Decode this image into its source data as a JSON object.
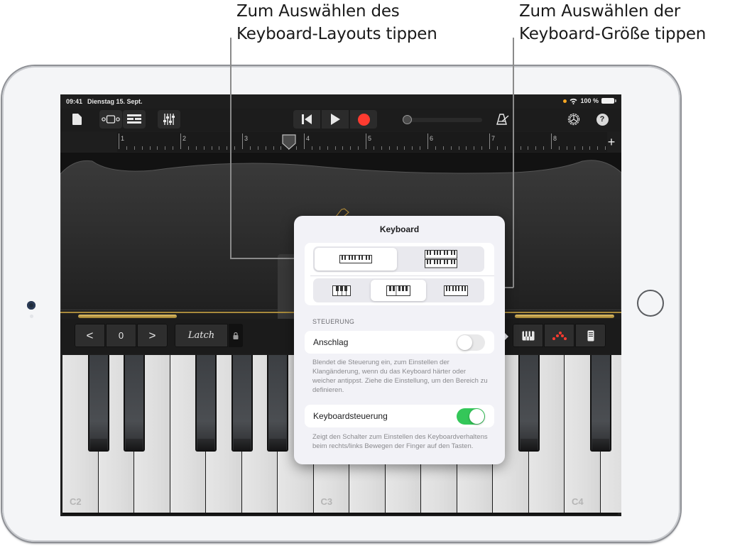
{
  "callouts": {
    "layout": "Zum Auswählen des\nKeyboard-Layouts tippen",
    "size": "Zum Auswählen der\nKeyboard-Größe tippen"
  },
  "status_bar": {
    "time": "09:41",
    "date": "Dienstag 15. Sept.",
    "battery": "100 %"
  },
  "toolbar": {
    "icons": [
      "document-icon",
      "view-toggle-icon",
      "tracks-icon",
      "mixer-icon",
      "rewind-icon",
      "play-icon",
      "record-icon",
      "volume-slider",
      "metronome-icon",
      "settings-icon",
      "help-icon"
    ],
    "help_label": "?",
    "accent_record": "#ff3b30"
  },
  "ruler": {
    "bars": [
      "1",
      "2",
      "3",
      "4",
      "5",
      "6",
      "7",
      "8"
    ],
    "add_label": "+"
  },
  "controls": {
    "octave_value": "0",
    "octave_down": "<",
    "octave_up": ">",
    "latch_label": "Latch",
    "right_buttons": [
      "keyboard-icon",
      "arpeggiator-icon",
      "keyboard-controls-icon"
    ],
    "arp_color": "#ff3b30"
  },
  "keyboard": {
    "labels": {
      "c2": "C2",
      "c3": "C3",
      "c4": "C4"
    }
  },
  "popover": {
    "title": "Keyboard",
    "layout_options": [
      "single-keyboard",
      "dual-keyboard"
    ],
    "layout_selected": "single-keyboard",
    "size_options": [
      "small-keys",
      "medium-keys",
      "large-keys"
    ],
    "size_selected": "medium-keys",
    "section_header": "STEUERUNG",
    "velocity": {
      "label": "Anschlag",
      "enabled": false,
      "footnote": "Blendet die Steuerung ein, zum Einstellen der Klangänderung, wenn du das Keyboard härter oder weicher antippst. Ziehe die Einstellung, um den Bereich zu definieren."
    },
    "keyboard_control": {
      "label": "Keyboardsteuerung",
      "enabled": true,
      "footnote": "Zeigt den Schalter zum Einstellen des Keyboardverhaltens beim rechts/links Bewegen der Finger auf den Tasten."
    },
    "toggle_on_color": "#34c759"
  }
}
